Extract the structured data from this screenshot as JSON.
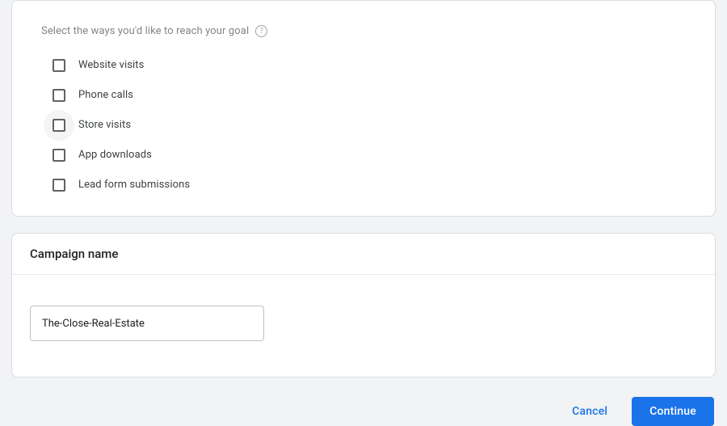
{
  "goals": {
    "title": "Select the ways you'd like to reach your goal",
    "options": [
      {
        "label": "Website visits"
      },
      {
        "label": "Phone calls"
      },
      {
        "label": "Store visits"
      },
      {
        "label": "App downloads"
      },
      {
        "label": "Lead form submissions"
      }
    ]
  },
  "campaign_name": {
    "title": "Campaign name",
    "value": "The-Close-Real-Estate"
  },
  "actions": {
    "cancel": "Cancel",
    "continue": "Continue"
  }
}
